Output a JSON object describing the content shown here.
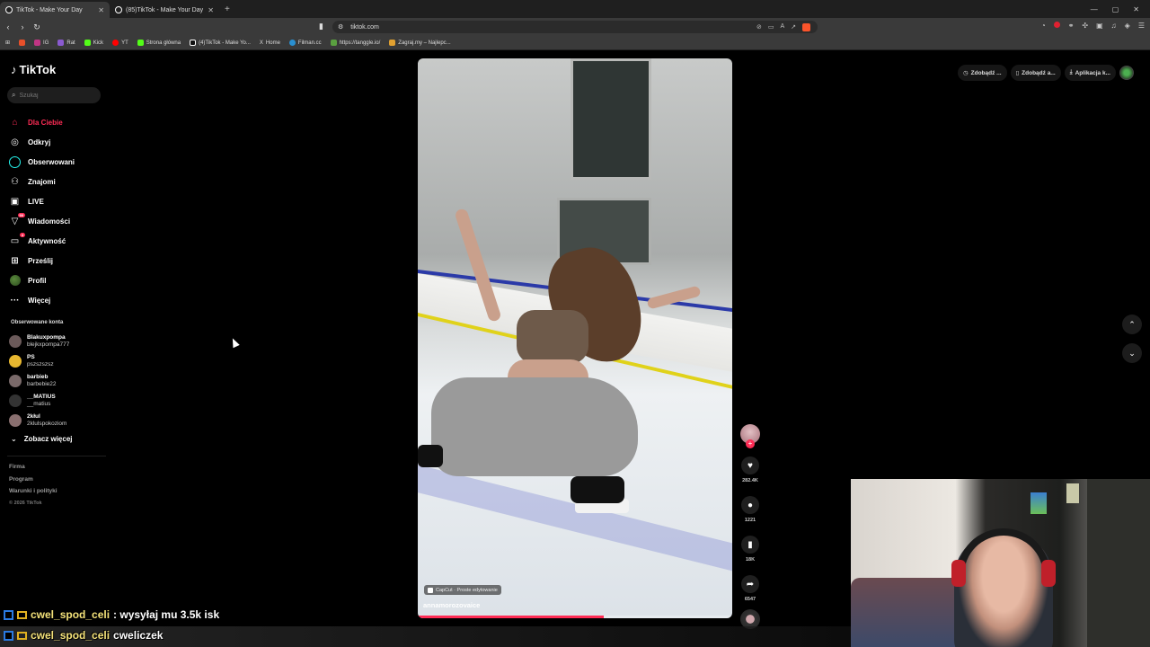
{
  "browser": {
    "tabs": [
      {
        "label": "TikTok - Make Your Day",
        "active": true
      },
      {
        "label": "(85)TikTok - Make Your Day",
        "active": false
      }
    ],
    "address": "tiktok.com",
    "bookmarks": [
      "IG",
      "Rat",
      "Kick",
      "YT",
      "Strona główna",
      "(4)TikTok - Make Yo...",
      "Home",
      "Filman.cc",
      "https://tanggle.io/",
      "Zagraj.my – Najlepс..."
    ]
  },
  "sidebar": {
    "logo": "TikTok",
    "search_placeholder": "Szukaj",
    "nav": [
      {
        "label": "Dla Ciebie",
        "icon": "home-icon",
        "active": true
      },
      {
        "label": "Odkryj",
        "icon": "compass-icon"
      },
      {
        "label": "Obserwowani",
        "icon": "following-ring-icon"
      },
      {
        "label": "Znajomi",
        "icon": "friends-icon"
      },
      {
        "label": "LIVE",
        "icon": "live-icon"
      },
      {
        "label": "Wiadomości",
        "icon": "messages-icon",
        "badge": "99"
      },
      {
        "label": "Aktywność",
        "icon": "activity-icon",
        "badge": "4"
      },
      {
        "label": "Prześlij",
        "icon": "upload-icon"
      },
      {
        "label": "Profil",
        "icon": "profile-avatar-icon"
      },
      {
        "label": "Więcej",
        "icon": "more-icon"
      }
    ],
    "followed_title": "Obserwowane konta",
    "followed": [
      {
        "name": "Blakuxpompa",
        "user": "blejkxpompa777",
        "color": "#6b5a5a"
      },
      {
        "name": "PS",
        "user": "pszszszsz",
        "color": "#e8b830"
      },
      {
        "name": "barbieb",
        "user": "barbebie22",
        "color": "#7a6a6a"
      },
      {
        "name": "__MATIUS",
        "user": "__matius",
        "color": "#333333"
      },
      {
        "name": "2kłul",
        "user": "2klulspokoziom",
        "color": "#8a7070"
      }
    ],
    "see_more": "Zobacz więcej",
    "footer": [
      "Firma",
      "Program",
      "Warunki i polityki"
    ],
    "copyright": "© 2026 TikTok"
  },
  "video": {
    "capcut": "CapCut · Proste edytowanie",
    "author": "annamorozovaice",
    "progress": 0.59
  },
  "actions": {
    "likes": "282.4K",
    "comments": "1221",
    "saves": "18K",
    "shares": "6547"
  },
  "topright": {
    "btn1": "Zdobądź ...",
    "btn2": "Zdobądź a...",
    "btn3": "Aplikacja k..."
  },
  "chat": {
    "line1_user": "cwel_spod_celi",
    "line1_msg": ": wysyłaj mu 3.5k isk",
    "line2_user": "cwel_spod_celi",
    "line2_msg": "cweliczek"
  },
  "colors": {
    "accent": "#fe2c55",
    "ring": "#25f4ee"
  }
}
